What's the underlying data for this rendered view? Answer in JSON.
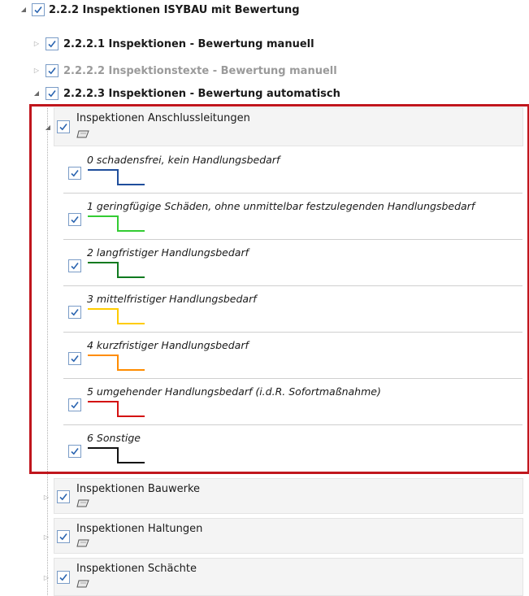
{
  "tree": {
    "root": {
      "label": "2.2.2 Inspektionen ISYBAU mit Bewertung",
      "checked": true
    },
    "children": [
      {
        "label": "2.2.2.1 Inspektionen - Bewertung manuell",
        "checked": true,
        "state": "collapsed"
      },
      {
        "label": "2.2.2.2 Inspektionstexte - Bewertung manuell",
        "checked": true,
        "state": "collapsed",
        "dimmed": true
      },
      {
        "label": "2.2.2.3 Inspektionen - Bewertung automatisch",
        "checked": true,
        "state": "expanded"
      }
    ],
    "layers": [
      {
        "label": "Inspektionen Anschlussleitungen",
        "checked": true,
        "state": "expanded"
      },
      {
        "label": "Inspektionen Bauwerke",
        "checked": true,
        "state": "collapsed"
      },
      {
        "label": "Inspektionen Haltungen",
        "checked": true,
        "state": "collapsed"
      },
      {
        "label": "Inspektionen Schächte",
        "checked": true,
        "state": "collapsed"
      }
    ],
    "classes": [
      {
        "label": "0 schadensfrei, kein Handlungsbedarf",
        "color": "#1f4e9c",
        "checked": true
      },
      {
        "label": "1 geringfügige Schäden, ohne unmittelbar festzulegenden Handlungsbedarf",
        "color": "#33cc33",
        "checked": true
      },
      {
        "label": "2 langfristiger Handlungsbedarf",
        "color": "#0f7a1f",
        "checked": true
      },
      {
        "label": "3 mittelfristiger Handlungsbedarf",
        "color": "#ffcc00",
        "checked": true
      },
      {
        "label": "4 kurzfristiger Handlungsbedarf",
        "color": "#ff8c00",
        "checked": true
      },
      {
        "label": "5 umgehender Handlungsbedarf (i.d.R. Sofortmaßnahme)",
        "color": "#d41111",
        "checked": true
      },
      {
        "label": "6 Sonstige",
        "color": "#111111",
        "checked": true
      }
    ]
  },
  "colors": {
    "highlight": "#c0161d",
    "checkbox_border": "#7a9cc7",
    "check": "#2a64b0"
  },
  "icons": {
    "expanded": "triangle-down-right-icon",
    "collapsed": "triangle-right-icon",
    "layer": "polygon-layer-icon",
    "check": "checkmark-icon"
  }
}
